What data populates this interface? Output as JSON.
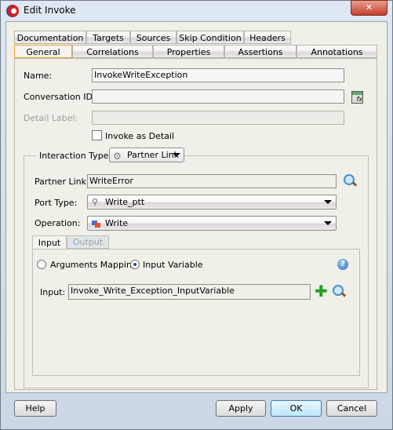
{
  "window": {
    "title": "Edit Invoke",
    "close": "✕"
  },
  "tabs_row1": [
    "Documentation",
    "Targets",
    "Sources",
    "Skip Condition",
    "Headers"
  ],
  "tabs_row2": [
    "General",
    "Correlations",
    "Properties",
    "Assertions",
    "Annotations"
  ],
  "form": {
    "name_label": "Name:",
    "name_value": "InvokeWriteException",
    "conversation_label": "Conversation ID:",
    "conversation_value": "",
    "detail_label": "Detail Label:",
    "detail_value": "",
    "invoke_detail_label": "Invoke as Detail",
    "invoke_detail_checked": false
  },
  "interaction": {
    "label": "Interaction Type:",
    "value": "Partner Link",
    "partner_link_label": "Partner Link:",
    "partner_link_value": "WriteError",
    "port_type_label": "Port Type:",
    "port_type_value": "Write_ptt",
    "operation_label": "Operation:",
    "operation_value": "Write"
  },
  "io_tabs": [
    "Input",
    "Output"
  ],
  "input": {
    "arguments_mapping": "Arguments Mapping",
    "input_variable": "Input Variable",
    "selected": "Input Variable",
    "input_label": "Input:",
    "input_value": "Invoke_Write_Exception_InputVariable"
  },
  "buttons": {
    "help": "Help",
    "apply": "Apply",
    "ok": "OK",
    "cancel": "Cancel"
  }
}
